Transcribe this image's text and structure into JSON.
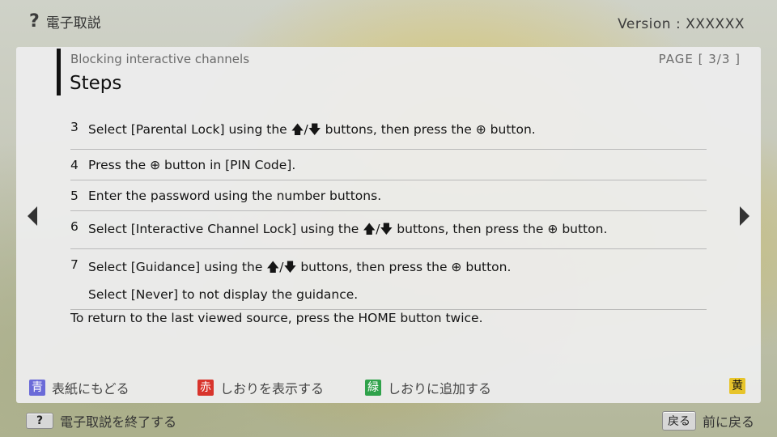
{
  "top": {
    "help_icon": "?",
    "app_title": "電子取説",
    "version": "Version : XXXXXX"
  },
  "panel": {
    "section": "Blocking interactive channels",
    "page": "PAGE [ 3/3 ]",
    "title": "Steps",
    "steps": [
      {
        "num": "3",
        "text": "Select [Parental Lock] using the ",
        "arrows": "🡅/🡇",
        "mid": " buttons, then press the ",
        "enter": "⊕",
        "end": " button."
      },
      {
        "num": "4",
        "text": "Press the ",
        "enter": "⊕",
        "end": " button in [PIN Code]."
      },
      {
        "num": "5",
        "text": "Enter the password using the number buttons."
      },
      {
        "num": "6",
        "text": "Select [Interactive Channel Lock] using the ",
        "arrows": "🡅/🡇",
        "mid": " buttons, then press the ",
        "enter": "⊕",
        "end": " button."
      },
      {
        "num": "7",
        "text": "Select [Guidance] using the ",
        "arrows": "🡅/🡇",
        "mid": " buttons, then press the ",
        "enter": "⊕",
        "end": " button.",
        "sub": "Select [Never] to not display the guidance."
      }
    ],
    "note": "To return to the last viewed source, press the HOME button twice."
  },
  "color_keys": {
    "blue_badge": "青",
    "blue_label": "表紙にもどる",
    "red_badge": "赤",
    "red_label": "しおりを表示する",
    "green_badge": "緑",
    "green_label": "しおりに追加する",
    "yellow_badge": "黄"
  },
  "bottom": {
    "help_key": "?",
    "exit_label": "電子取説を終了する",
    "back_key": "戻る",
    "back_label": "前に戻る"
  },
  "colors": {
    "blue": "#6b6bd8",
    "red": "#d8342c",
    "green": "#2fa24a",
    "yellow": "#e7c42a"
  }
}
